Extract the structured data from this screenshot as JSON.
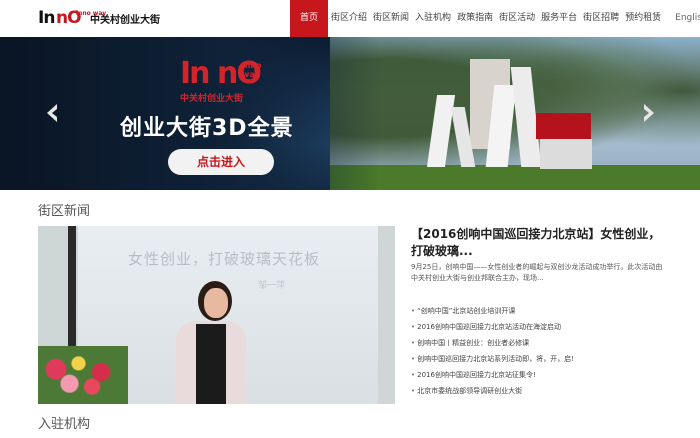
{
  "header": {
    "logo": {
      "mark_black": "In",
      "mark_red": "nO",
      "mark_small": "inno way",
      "name": "中关村创业大街"
    },
    "nav": [
      {
        "label": "首页",
        "active": true
      },
      {
        "label": "街区介绍"
      },
      {
        "label": "街区新闻"
      },
      {
        "label": "入驻机构"
      },
      {
        "label": "政策指南"
      },
      {
        "label": "街区活动"
      },
      {
        "label": "服务平台"
      },
      {
        "label": "街区招聘"
      },
      {
        "label": "预约租赁"
      },
      {
        "label": "English"
      }
    ]
  },
  "banner": {
    "logo_mark": "In nO",
    "logo_small": "inno way",
    "logo_cn": "中关村创业大街",
    "title": "创业大街3D全景",
    "button": "点击进入",
    "prev_icon": "chevron-left-icon",
    "next_icon": "chevron-right-icon"
  },
  "news": {
    "section_title": "街区新闻",
    "photo": {
      "screen_text": "女性创业，打破玻璃天花板",
      "screen_sub": "邹一萍"
    },
    "headline": "【2016创响中国巡回接力北京站】女性创业，打破玻璃...",
    "summary": "9月25日，创响中国——女性创业者的崛起与双创沙龙活动成功举行。此次活动由中关村创业大街与创业邦联合主办，现场...",
    "items": [
      "“创响中国”北京站创业培训开课",
      "2016创响中国巡回接力北京站活动在海淀启动",
      "创响中国丨精益创业：创业者必修课",
      "创响中国巡回接力北京站系列活动即，将，开，启!",
      "2016创响中国巡回接力北京站征集令!",
      "北京市委统战部领导调研创业大街"
    ]
  },
  "institutions": {
    "section_title": "入驻机构"
  },
  "colors": {
    "brand_red": "#c8161d",
    "text_dark": "#222222",
    "text_muted": "#555555"
  }
}
